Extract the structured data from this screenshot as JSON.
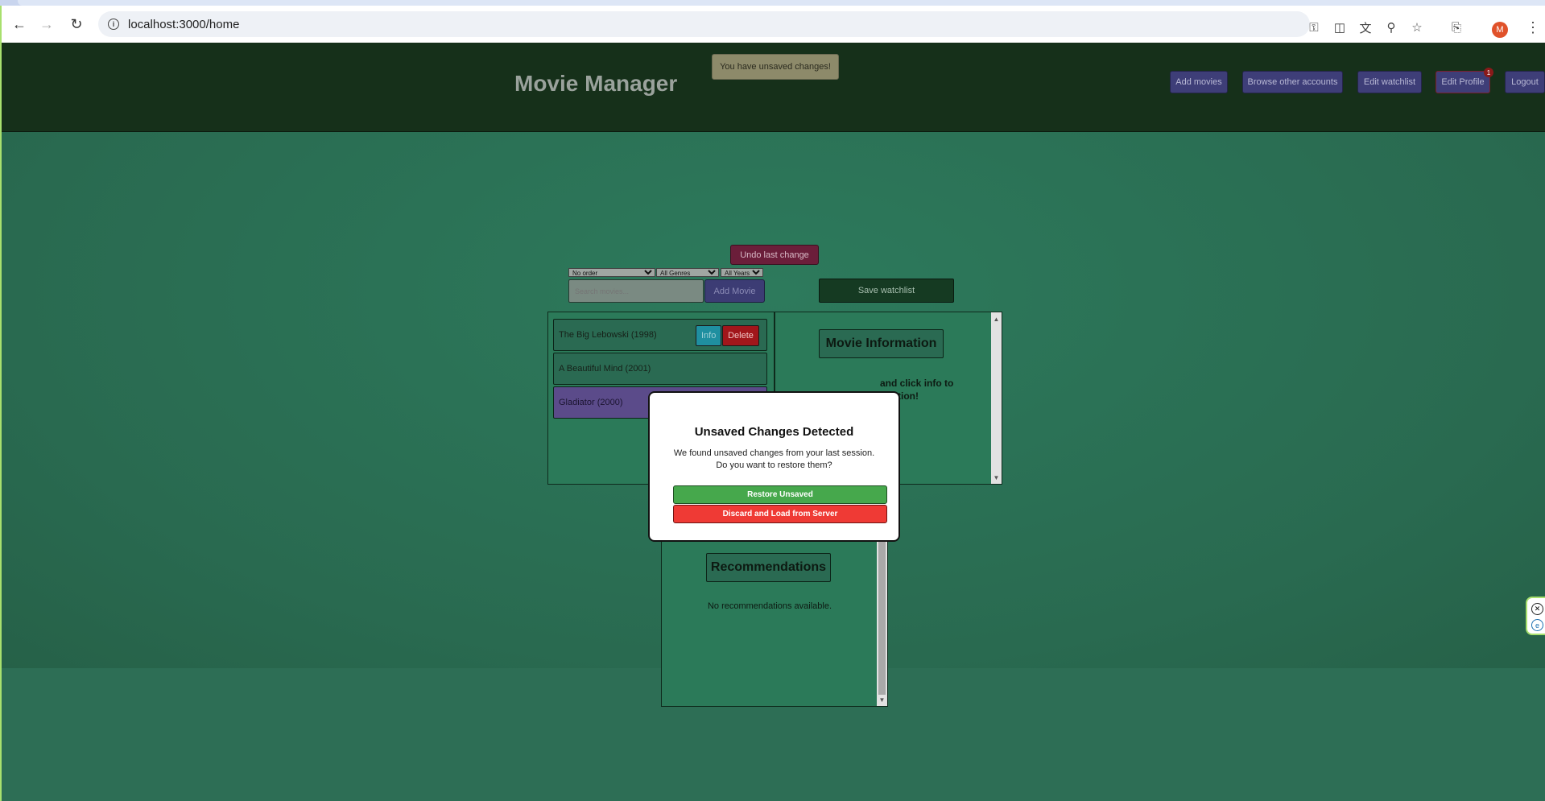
{
  "browser": {
    "url": "localhost:3000/home",
    "profile_initial": "M"
  },
  "header": {
    "title": "Movie Manager",
    "toast": "You have unsaved changes!",
    "nav": {
      "add_movies": "Add movies",
      "browse_accounts": "Browse other accounts",
      "edit_watchlist": "Edit watchlist",
      "edit_profile": "Edit Profile",
      "edit_profile_badge": "1",
      "logout": "Logout"
    }
  },
  "controls": {
    "undo": "Undo last change",
    "order_selected": "No order",
    "genre_selected": "All Genres",
    "year_selected": "All Years",
    "search_placeholder": "Search movies...",
    "add_movie": "Add Movie",
    "save_watchlist": "Save watchlist"
  },
  "watchlist": {
    "items": [
      {
        "title": "The Big Lebowski (1998)"
      },
      {
        "title": "A Beautiful Mind (2001)"
      },
      {
        "title": "Gladiator (2000)"
      }
    ],
    "info_label": "Info",
    "delete_label": "Delete"
  },
  "info_panel": {
    "title": "Movie Information",
    "hint": "and click info to\nrmation!"
  },
  "recommendations": {
    "title": "Recommendations",
    "empty": "No recommendations available."
  },
  "modal": {
    "title": "Unsaved Changes Detected",
    "message": "We found unsaved changes from your last session. Do you want to restore them?",
    "restore": "Restore Unsaved",
    "discard": "Discard and Load from Server"
  }
}
